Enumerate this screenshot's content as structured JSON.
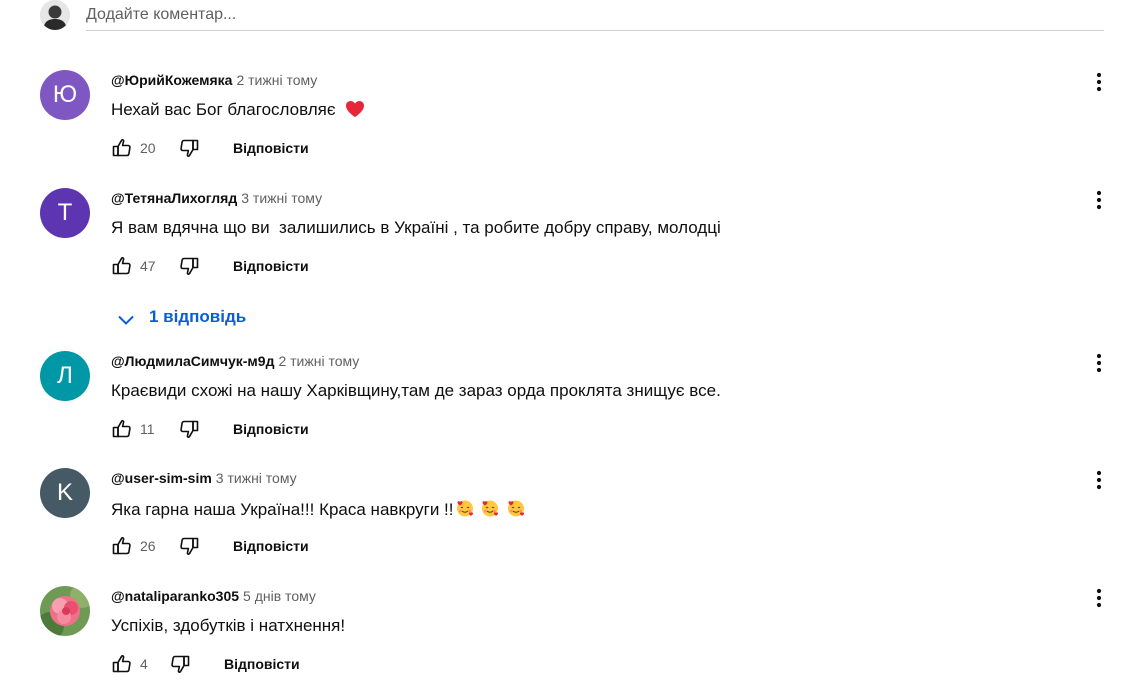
{
  "add_comment": {
    "placeholder": "Додайте коментар..."
  },
  "colors": {
    "link_blue": "#065fd4",
    "secondary_text": "#606060"
  },
  "comments": [
    {
      "author": "@ЮрийКожемяка",
      "time": "2 тижні тому",
      "text": "Нехай вас Бог благословляє",
      "emoji": "red-heart",
      "likes": "20",
      "reply_label": "Відповісти",
      "avatar_letter": "Ю",
      "avatar_color": "#7e57c2"
    },
    {
      "author": "@ТетянаЛихогляд",
      "time": "3 тижні тому",
      "text": "Я вам вдячна що ви  залишились в Україні , та робите добру справу, молодці",
      "likes": "47",
      "reply_label": "Відповісти",
      "avatar_letter": "Т",
      "avatar_color": "#5e35b1",
      "replies_label": "1 відповідь"
    },
    {
      "author": "@ЛюдмилаСимчук-м9д",
      "time": "2 тижні тому",
      "text": "Краєвиди схожі на нашу Харківщину,там де зараз орда проклята знищує все.",
      "likes": "11",
      "reply_label": "Відповісти",
      "avatar_letter": "Л",
      "avatar_color": "#0097a7"
    },
    {
      "author": "@user-sim-sim",
      "time": "3 тижні тому",
      "text": "Яка гарна наша Україна!!! Краса навкруги !!",
      "emoji": "smiling-face-with-hearts x3",
      "likes": "26",
      "reply_label": "Відповісти",
      "avatar_letter": "K",
      "avatar_color": "#455a64"
    },
    {
      "author": "@nataliparanko305",
      "time": "5 днів тому",
      "text": "Успіхів, здобутків і натхнення!",
      "likes": "4",
      "reply_label": "Відповісти",
      "avatar_image": "pink-flower-photo"
    }
  ]
}
